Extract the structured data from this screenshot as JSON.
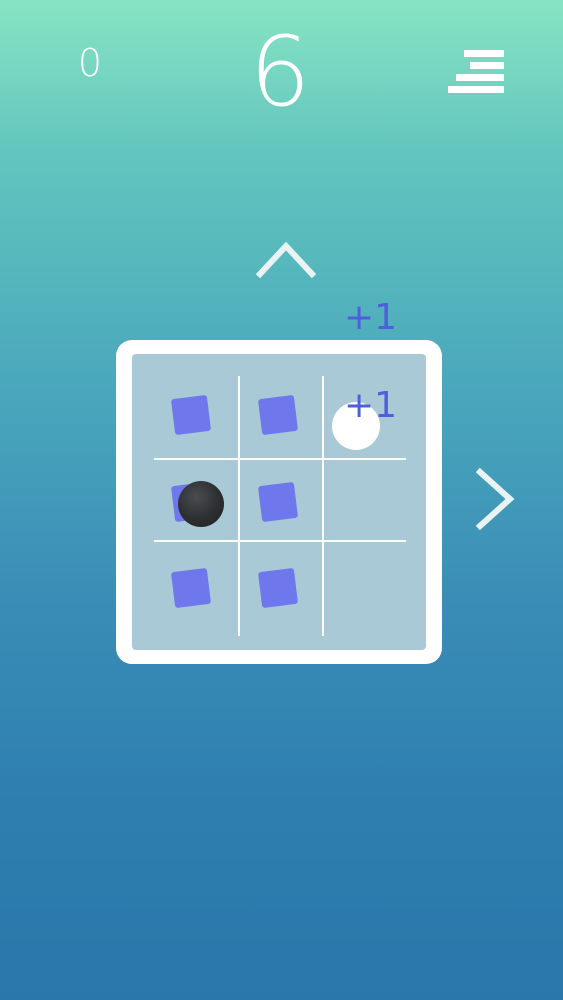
{
  "hud": {
    "score": "0",
    "moves_remaining": "6",
    "menu_icon": "menu-icon"
  },
  "controls": {
    "up_arrow_icon": "chevron-up-icon",
    "right_arrow_icon": "chevron-right-icon"
  },
  "popups": {
    "outside_label": "+1",
    "inside_label": "+1"
  },
  "board": {
    "rows": 3,
    "cols": 3,
    "cells": [
      [
        "tile",
        "tile",
        "white-ball"
      ],
      [
        "tile+black-ball",
        "tile",
        "empty"
      ],
      [
        "tile",
        "tile",
        "empty"
      ]
    ]
  },
  "colors": {
    "tile": "#6E77EC",
    "board_frame": "#FFFFFF",
    "board_bg": "#A9C9D7",
    "popup_text": "#4F5FDB",
    "bg_top": "#87E4C3",
    "bg_bottom": "#2A77AB"
  }
}
